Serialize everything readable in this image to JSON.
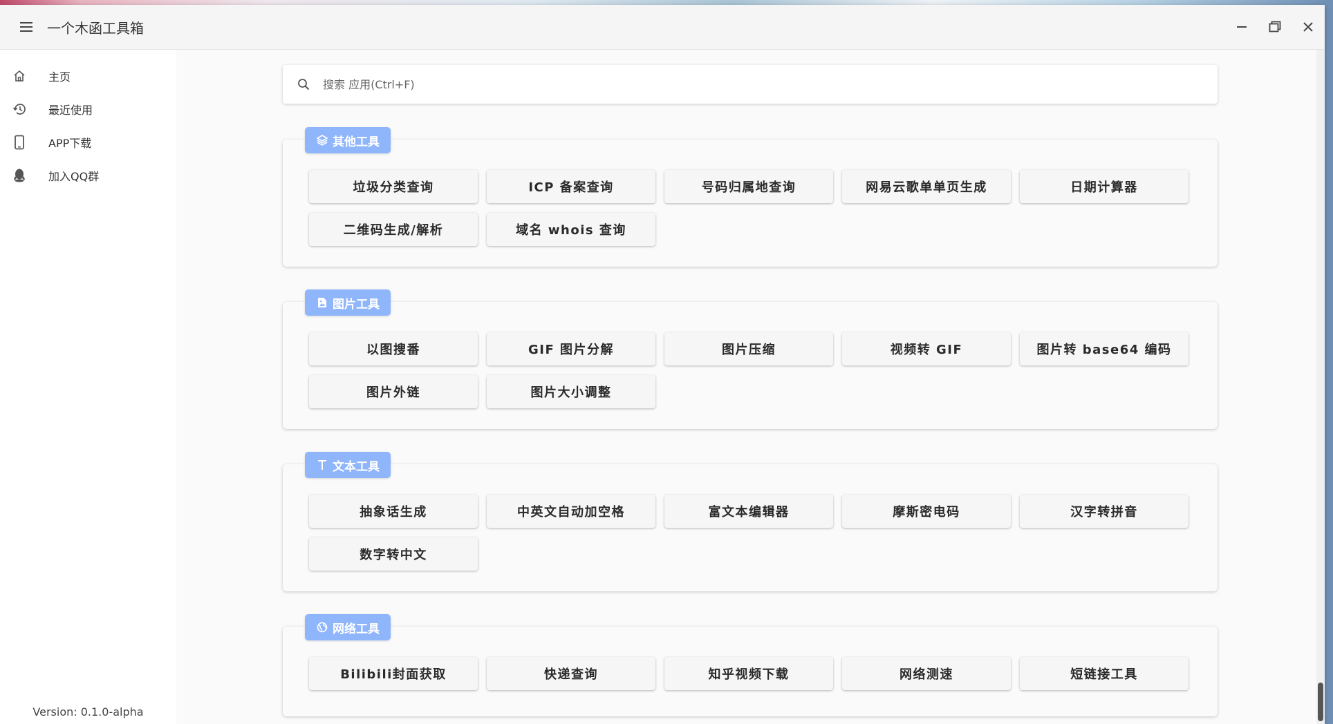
{
  "window": {
    "title": "一个木函工具箱",
    "icons": {
      "menu": "hamburger-icon",
      "minimize": "minimize-icon",
      "maximize": "maximize-icon",
      "close": "close-icon"
    }
  },
  "sidebar": {
    "items": [
      {
        "label": "主页",
        "icon": "home-icon"
      },
      {
        "label": "最近使用",
        "icon": "history-icon"
      },
      {
        "label": "APP下载",
        "icon": "phone-icon"
      },
      {
        "label": "加入QQ群",
        "icon": "qq-icon"
      }
    ],
    "version": "Version: 0.1.0-alpha"
  },
  "search": {
    "placeholder": "搜索 应用(Ctrl+F)",
    "value": ""
  },
  "sections": [
    {
      "label": "其他工具",
      "icon": "layers-icon",
      "tools": [
        "垃圾分类查询",
        "ICP 备案查询",
        "号码归属地查询",
        "网易云歌单单页生成",
        "日期计算器",
        "二维码生成/解析",
        "域名 whois 查询"
      ]
    },
    {
      "label": "图片工具",
      "icon": "image-file-icon",
      "tools": [
        "以图搜番",
        "GIF 图片分解",
        "图片压缩",
        "视频转 GIF",
        "图片转 base64 编码",
        "图片外链",
        "图片大小调整"
      ]
    },
    {
      "label": "文本工具",
      "icon": "text-icon",
      "tools": [
        "抽象话生成",
        "中英文自动加空格",
        "富文本编辑器",
        "摩斯密电码",
        "汉字转拼音",
        "数字转中文"
      ]
    },
    {
      "label": "网络工具",
      "icon": "globe-icon",
      "tools": [
        "Bilibili封面获取",
        "快递查询",
        "知乎视频下载",
        "网络测速",
        "短链接工具"
      ]
    }
  ],
  "colors": {
    "accent": "#8fb5fb",
    "window_bg": "#fafafa",
    "sidebar_bg": "#ffffff"
  }
}
